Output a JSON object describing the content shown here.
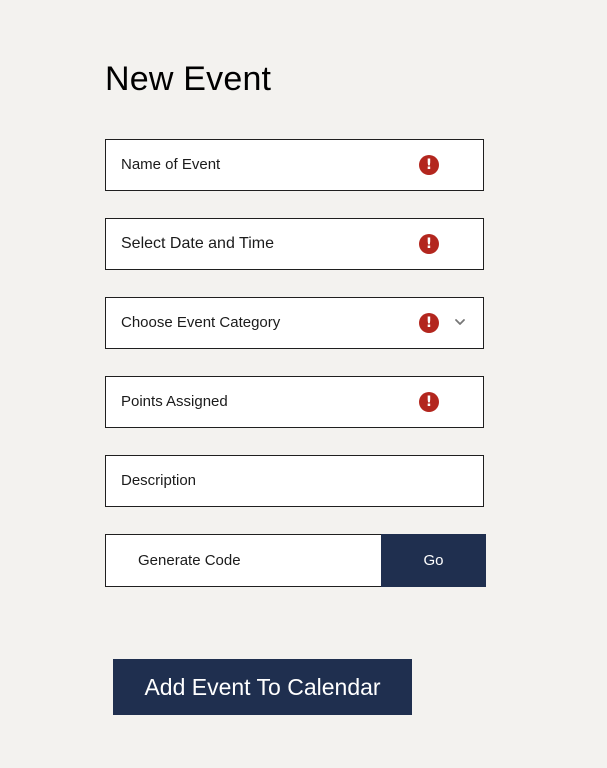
{
  "page": {
    "title": "New Event"
  },
  "form": {
    "fields": [
      {
        "label": "Name of Event",
        "error_icon": "error-icon"
      },
      {
        "label": "Select Date and Time",
        "error_icon": "error-icon"
      },
      {
        "label": "Choose Event Category",
        "error_icon": "error-icon",
        "dropdown_icon": "chevron-down-icon"
      },
      {
        "label": "Points Assigned",
        "error_icon": "error-icon"
      },
      {
        "label": "Description"
      }
    ],
    "code": {
      "label": "Generate Code",
      "button_label": "Go"
    },
    "submit_label": "Add Event To Calendar"
  },
  "colors": {
    "background": "#f3f2ef",
    "primary": "#1f2f4f",
    "error": "#b3261e"
  },
  "icons": {
    "error": "!"
  }
}
